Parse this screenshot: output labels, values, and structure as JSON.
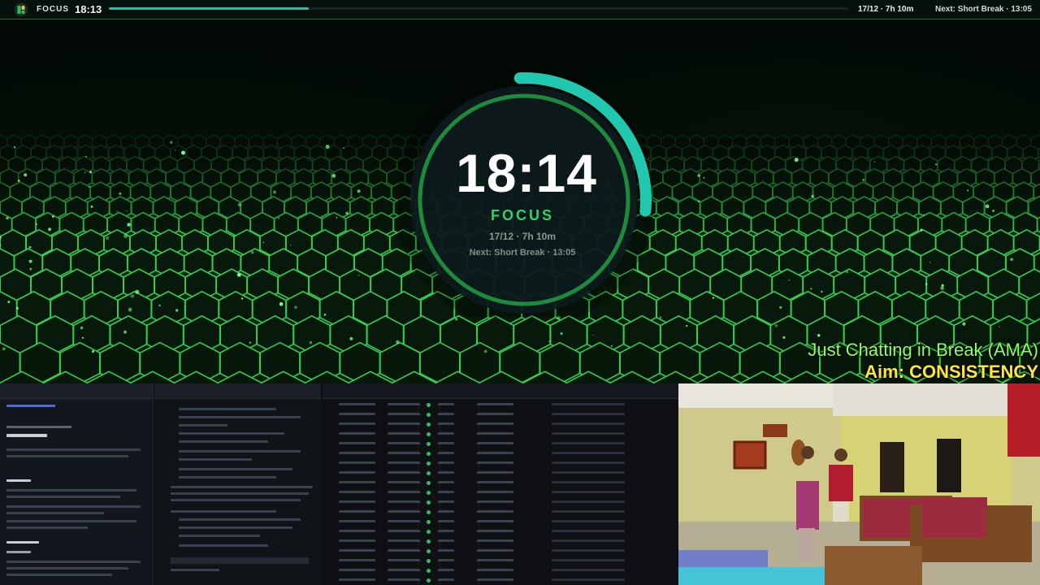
{
  "topbar": {
    "mode": "FOCUS",
    "time": "18:13",
    "progress": 0.27,
    "date_info": "17/12 · 7h 10m",
    "next": "Next: Short Break · 13:05"
  },
  "timer": {
    "time": "18:14",
    "mode": "FOCUS",
    "date_info": "17/12 · 7h 10m",
    "next": "Next: Short Break · 13:05",
    "ring_progress": 0.27
  },
  "overlay": {
    "line1": "Just Chatting in Break (AMA)",
    "line2": "Aim: CONSISTENCY"
  },
  "colors": {
    "accent": "#20c0a4",
    "focus_green": "#32d06c",
    "overlay_green": "#8dff5f",
    "overlay_yellow": "#ffe63b"
  },
  "icons": {
    "app_logo": "app-logo-icon"
  }
}
